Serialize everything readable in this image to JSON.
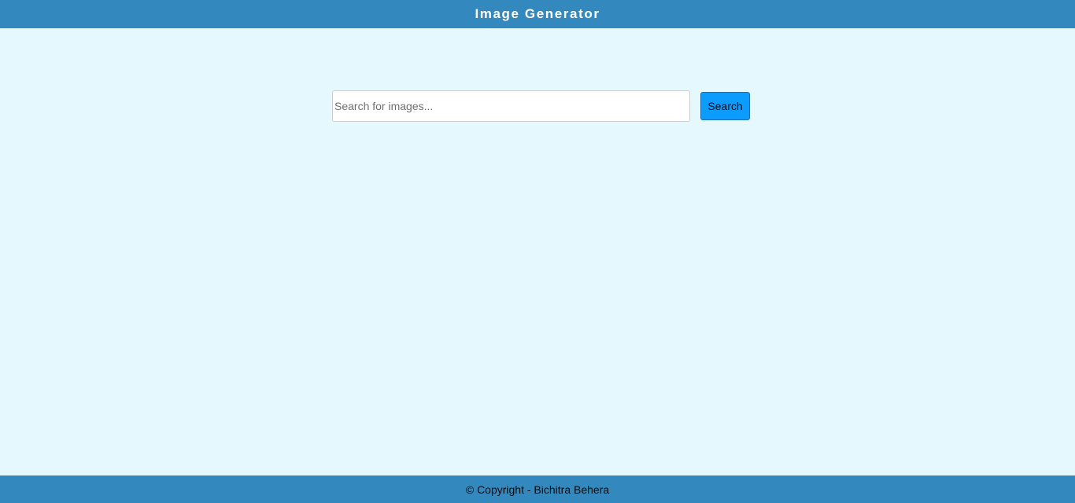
{
  "header": {
    "title": "Image Generator"
  },
  "search": {
    "placeholder": "Search for images...",
    "value": "",
    "button_label": "Search"
  },
  "footer": {
    "copyright": "© Copyright - Bichitra Behera"
  },
  "colors": {
    "header_bg": "#3389be",
    "page_bg": "#e4f8fd",
    "button_bg": "#0c9cff",
    "footer_bg": "#3389be"
  }
}
